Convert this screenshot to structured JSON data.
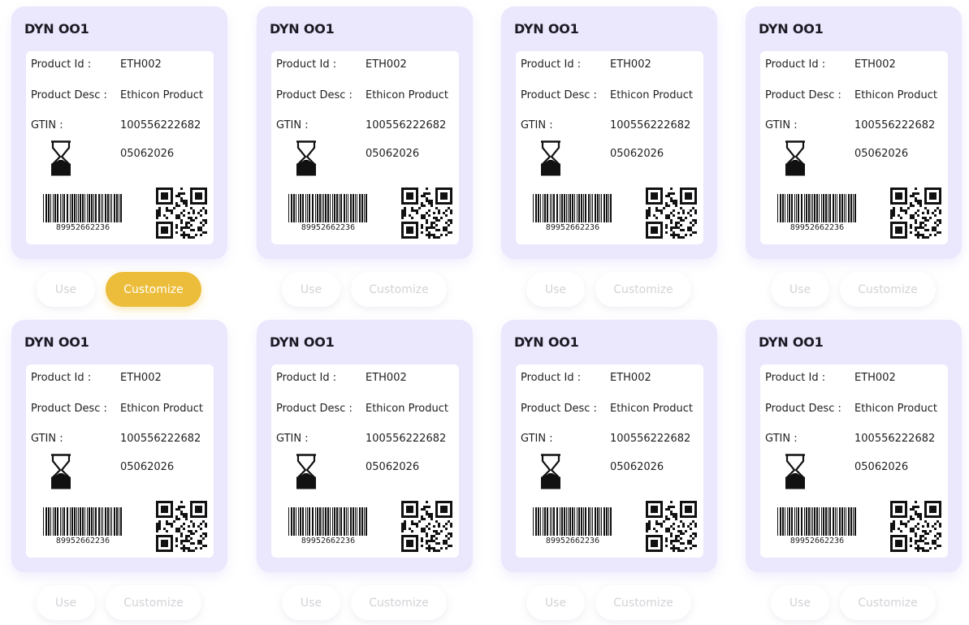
{
  "colors": {
    "card_background": "#ebe7fd",
    "active_button": "#ecbd3a",
    "inactive_button_text": "#d3d3d8"
  },
  "icons": {
    "expiry": "hourglass-icon",
    "barcode": "barcode-icon",
    "qr": "qr-code-icon"
  },
  "cards": [
    {
      "title": "DYN OO1",
      "product_id_label": "Product Id :",
      "product_id": "ETH002",
      "desc_label": "Product Desc :",
      "desc": "Ethicon Product",
      "gtin_label": "GTIN :",
      "gtin": "100556222682",
      "expiry": "05062026",
      "barcode": "89952662236",
      "use_label": "Use",
      "customize_label": "Customize",
      "customize_active": true
    },
    {
      "title": "DYN OO1",
      "product_id_label": "Product Id :",
      "product_id": "ETH002",
      "desc_label": "Product Desc :",
      "desc": "Ethicon Product",
      "gtin_label": "GTIN :",
      "gtin": "100556222682",
      "expiry": "05062026",
      "barcode": "89952662236",
      "use_label": "Use",
      "customize_label": "Customize",
      "customize_active": false
    },
    {
      "title": "DYN OO1",
      "product_id_label": "Product Id :",
      "product_id": "ETH002",
      "desc_label": "Product Desc :",
      "desc": "Ethicon Product",
      "gtin_label": "GTIN :",
      "gtin": "100556222682",
      "expiry": "05062026",
      "barcode": "89952662236",
      "use_label": "Use",
      "customize_label": "Customize",
      "customize_active": false
    },
    {
      "title": "DYN OO1",
      "product_id_label": "Product Id :",
      "product_id": "ETH002",
      "desc_label": "Product Desc :",
      "desc": "Ethicon Product",
      "gtin_label": "GTIN :",
      "gtin": "100556222682",
      "expiry": "05062026",
      "barcode": "89952662236",
      "use_label": "Use",
      "customize_label": "Customize",
      "customize_active": false
    },
    {
      "title": "DYN OO1",
      "product_id_label": "Product Id :",
      "product_id": "ETH002",
      "desc_label": "Product Desc :",
      "desc": "Ethicon Product",
      "gtin_label": "GTIN :",
      "gtin": "100556222682",
      "expiry": "05062026",
      "barcode": "89952662236",
      "use_label": "Use",
      "customize_label": "Customize",
      "customize_active": false
    },
    {
      "title": "DYN OO1",
      "product_id_label": "Product Id :",
      "product_id": "ETH002",
      "desc_label": "Product Desc :",
      "desc": "Ethicon Product",
      "gtin_label": "GTIN :",
      "gtin": "100556222682",
      "expiry": "05062026",
      "barcode": "89952662236",
      "use_label": "Use",
      "customize_label": "Customize",
      "customize_active": false
    },
    {
      "title": "DYN OO1",
      "product_id_label": "Product Id :",
      "product_id": "ETH002",
      "desc_label": "Product Desc :",
      "desc": "Ethicon Product",
      "gtin_label": "GTIN :",
      "gtin": "100556222682",
      "expiry": "05062026",
      "barcode": "89952662236",
      "use_label": "Use",
      "customize_label": "Customize",
      "customize_active": false
    },
    {
      "title": "DYN OO1",
      "product_id_label": "Product Id :",
      "product_id": "ETH002",
      "desc_label": "Product Desc :",
      "desc": "Ethicon Product",
      "gtin_label": "GTIN :",
      "gtin": "100556222682",
      "expiry": "05062026",
      "barcode": "89952662236",
      "use_label": "Use",
      "customize_label": "Customize",
      "customize_active": false
    }
  ]
}
